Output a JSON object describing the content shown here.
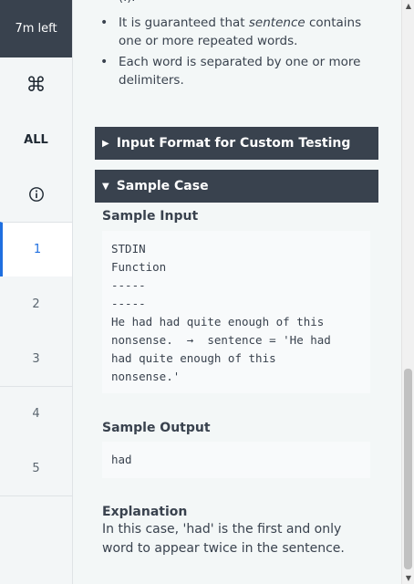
{
  "sidebar": {
    "timer": "7m left",
    "command_symbol": "⌘",
    "all_label": "ALL",
    "info_icon": "info-circle-icon",
    "questions": [
      "1",
      "2",
      "3",
      "4",
      "5"
    ],
    "active_question": "1"
  },
  "content": {
    "partial_top": "(.).",
    "bullets": [
      {
        "pre": "It is guaranteed that ",
        "em": "sentence",
        "post": " contains one or more repeated words."
      },
      {
        "pre": "Each word is separated by one or more delimiters.",
        "em": "",
        "post": ""
      }
    ],
    "input_format_title": "Input Format for Custom Testing",
    "sample_case_title": "Sample Case",
    "sample_input_label": "Sample Input",
    "sample_input_code": "STDIN\nFunction\n-----\n-----\nHe had had quite enough of this\nnonsense.  →  sentence = 'He had\nhad quite enough of this\nnonsense.'",
    "sample_output_label": "Sample Output",
    "sample_output_code": "had",
    "explanation_label": "Explanation",
    "explanation_text": "In this case, 'had' is the first and only word to appear twice in the sentence."
  },
  "colors": {
    "dark_bar": "#39424e",
    "accent": "#1f6fe0",
    "sidebar_bg": "#f3f6f7"
  }
}
